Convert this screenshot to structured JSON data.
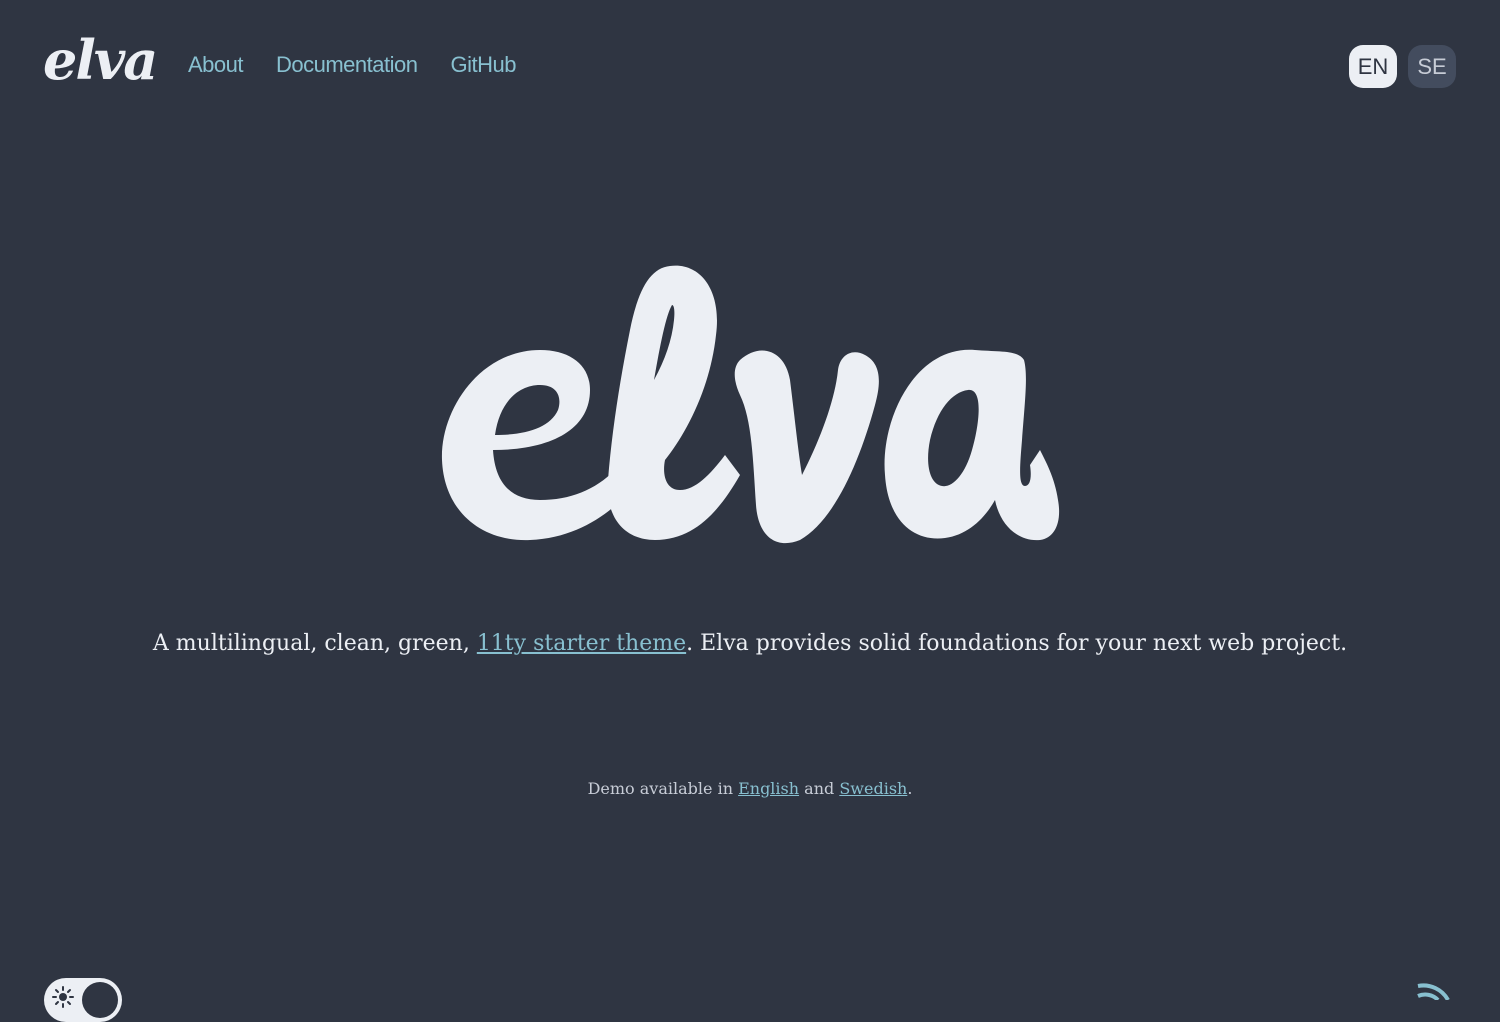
{
  "header": {
    "logo_text": "elva",
    "nav": [
      {
        "label": "About"
      },
      {
        "label": "Documentation"
      },
      {
        "label": "GitHub"
      }
    ],
    "languages": [
      {
        "code": "EN",
        "active": true
      },
      {
        "code": "SE",
        "active": false
      }
    ]
  },
  "hero": {
    "logo_text": "elva",
    "tagline_prefix": "A multilingual, clean, green, ",
    "tagline_link": "11ty starter theme",
    "tagline_suffix": ". Elva provides solid foundations for your next web project."
  },
  "demo": {
    "prefix": "Demo available in ",
    "english_link": "English",
    "middle": " and ",
    "swedish_link": "Swedish",
    "suffix": "."
  },
  "footer": {
    "theme_toggle_icon": "sun-icon",
    "feed_icon": "rss-icon"
  },
  "colors": {
    "background": "#2f3542",
    "text": "#eceff4",
    "accent": "#88c0d0"
  }
}
